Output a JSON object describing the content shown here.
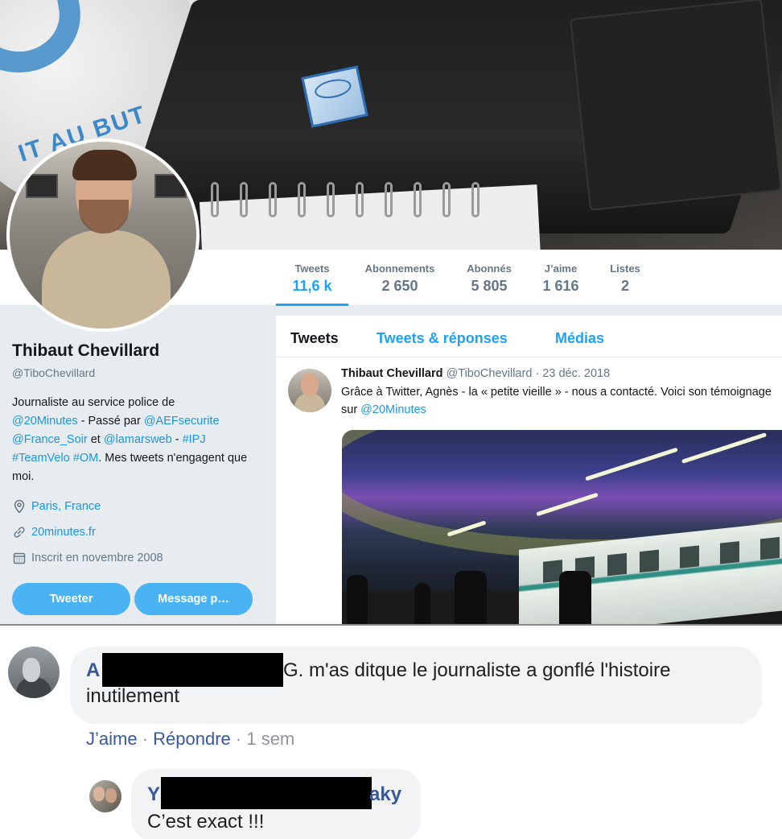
{
  "twitter": {
    "stats": [
      {
        "label": "Tweets",
        "value": "11,6 k"
      },
      {
        "label": "Abonnements",
        "value": "2 650"
      },
      {
        "label": "Abonnés",
        "value": "5 805"
      },
      {
        "label": "J’aime",
        "value": "1 616"
      },
      {
        "label": "Listes",
        "value": "2"
      }
    ],
    "profile": {
      "name": "Thibaut Chevillard",
      "handle": "@TiboChevillard",
      "bio": {
        "t1": "Journaliste au service police de",
        "m1": "@20Minutes",
        "t2": " - Passé par ",
        "m2": "@AEFsecurite",
        "m3": "@France_Soir",
        "t3": " et ",
        "m4": "@lamarsweb",
        "t4": " - ",
        "m5": "#IPJ",
        "m6": "#TeamVelo",
        "m7": "#OM",
        "t5": ". Mes tweets n'engagent que moi."
      },
      "location": "Paris, France",
      "website": "20minutes.fr",
      "joined": "Inscrit en novembre 2008",
      "tweet_button": "Tweeter",
      "message_button": "Message p…"
    },
    "tabs": [
      "Tweets",
      "Tweets & réponses",
      "Médias"
    ],
    "tweet": {
      "author": "Thibaut Chevillard",
      "handle": "@TiboChevillard",
      "date": " · 23 déc. 2018",
      "text": "Grâce à Twitter, Agnès - la « petite vieille » - nous a contacté. Voici son témoignage sur ",
      "mention": "@20Minutes"
    },
    "colors": {
      "accent": "#1da1f2",
      "link": "#1b95e0",
      "button": "#4ab3f4"
    }
  },
  "facebook": {
    "comment1": {
      "name_start": "A",
      "text_line1": "G. m'as ditque le journaliste a gonflé l'histoire",
      "text_line2": "inutilement",
      "like": "J’aime",
      "sep1": " · ",
      "reply": "Répondre",
      "sep2": " · ",
      "time": "1 sem"
    },
    "comment2": {
      "name_start": "Y",
      "name_end": "aky",
      "text": "C’est exact !!!"
    },
    "colors": {
      "name": "#385898",
      "bubble": "#f2f3f5"
    }
  }
}
